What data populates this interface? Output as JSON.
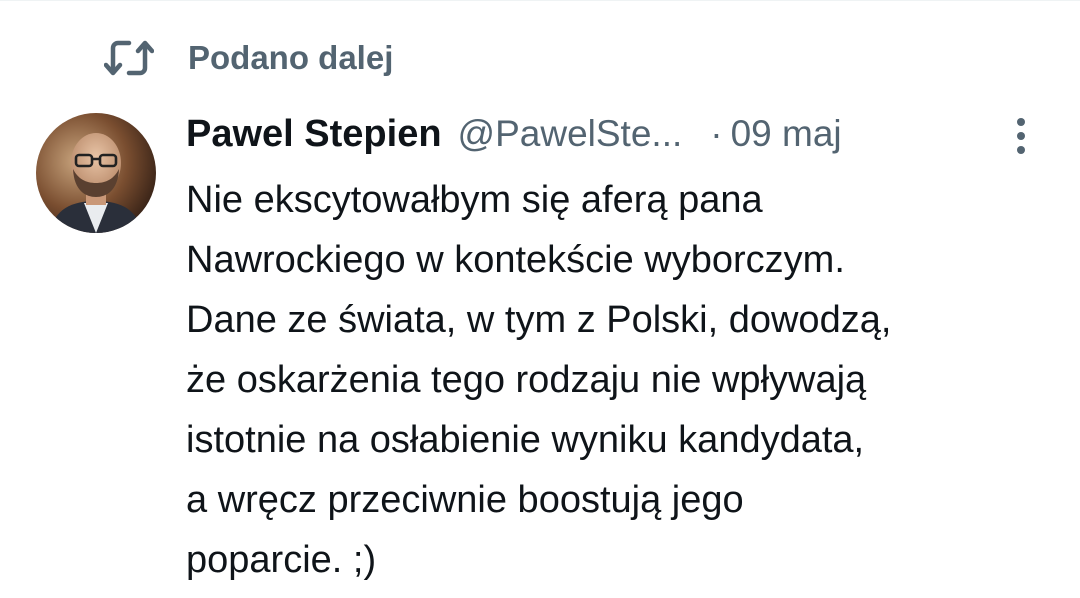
{
  "repost": {
    "icon": "repost-icon",
    "label": "Podano dalej"
  },
  "post": {
    "author": {
      "display_name": "Pawel Stepien",
      "handle": "@PawelSte...",
      "avatar_icon": "avatar-photo"
    },
    "separator": "·",
    "timestamp": "09 maj",
    "more_icon": "more-vertical-icon",
    "text_lines": [
      "Nie ekscytowałbym się aferą pana",
      "Nawrockiego w kontekście wyborczym.",
      "Dane ze świata, w tym z Polski, dowodzą,",
      "że oskarżenia tego rodzaju nie wpływają",
      "istotnie na osłabienie wyniku kandydata,",
      "a wręcz przeciwnie boostują jego",
      "poparcie. ;)"
    ]
  },
  "colors": {
    "primary_text": "#0f1419",
    "secondary_text": "#536471",
    "background": "#ffffff"
  }
}
